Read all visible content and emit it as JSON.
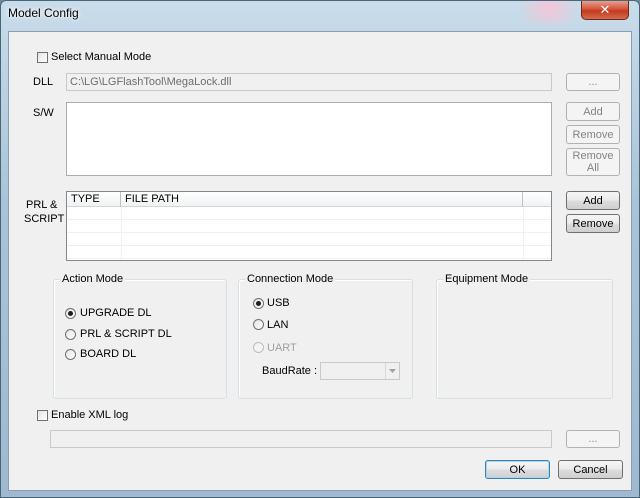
{
  "window": {
    "title": "Model Config",
    "close_glyph": "✕"
  },
  "manual_mode": {
    "label": "Select Manual Mode",
    "checked": false
  },
  "dll": {
    "label": "DLL",
    "path": "C:\\LG\\LGFlashTool\\MegaLock.dll",
    "browse_label": "..."
  },
  "sw": {
    "label": "S/W",
    "add_label": "Add",
    "remove_label": "Remove",
    "remove_all_label": "Remove All"
  },
  "prl": {
    "label_line1": "PRL  &",
    "label_line2": "SCRIPT",
    "columns": [
      "TYPE",
      "FILE PATH"
    ],
    "add_label": "Add",
    "remove_label": "Remove"
  },
  "action_mode": {
    "title": "Action Mode",
    "options": [
      {
        "label": "UPGRADE DL",
        "checked": true
      },
      {
        "label": "PRL & SCRIPT DL",
        "checked": false
      },
      {
        "label": "BOARD DL",
        "checked": false
      }
    ]
  },
  "connection_mode": {
    "title": "Connection Mode",
    "options": [
      {
        "label": "USB",
        "checked": true,
        "enabled": true
      },
      {
        "label": "LAN",
        "checked": false,
        "enabled": true
      },
      {
        "label": "UART",
        "checked": false,
        "enabled": false
      }
    ],
    "baudrate_label": "BaudRate :",
    "baudrate_value": ""
  },
  "equipment_mode": {
    "title": "Equipment Mode"
  },
  "xml_log": {
    "label": "Enable XML log",
    "checked": false,
    "path": "",
    "browse_label": "..."
  },
  "footer": {
    "ok_label": "OK",
    "cancel_label": "Cancel"
  }
}
